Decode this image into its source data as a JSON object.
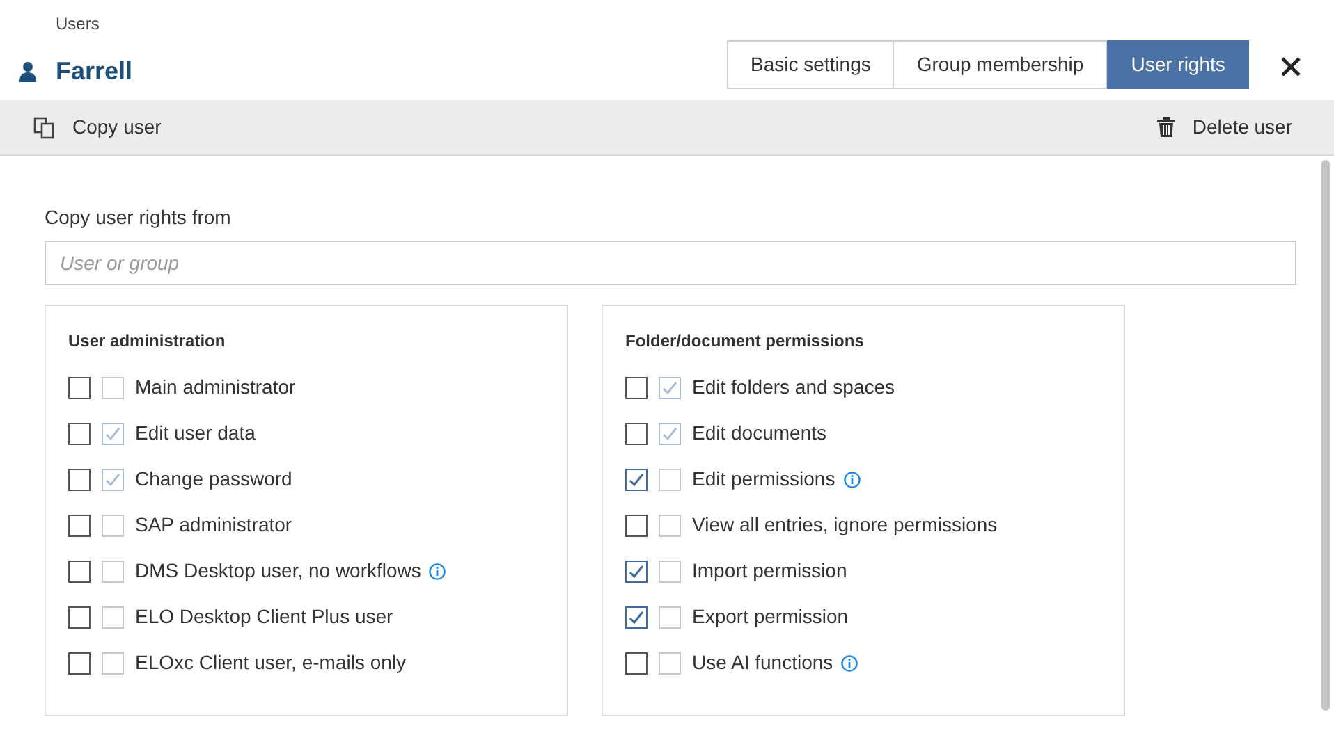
{
  "breadcrumb": "Users",
  "title": "Farrell",
  "tabs": [
    {
      "label": "Basic settings",
      "selected": false
    },
    {
      "label": "Group membership",
      "selected": false
    },
    {
      "label": "User rights",
      "selected": true
    }
  ],
  "toolbar": {
    "copy": "Copy user",
    "delete": "Delete user"
  },
  "copy_from": {
    "label": "Copy user rights from",
    "placeholder": "User or group"
  },
  "panels": [
    {
      "title": "User administration",
      "rights": [
        {
          "label": "Main administrator",
          "checked": false,
          "inherited": false,
          "info": false
        },
        {
          "label": "Edit user data",
          "checked": false,
          "inherited": true,
          "info": false
        },
        {
          "label": "Change password",
          "checked": false,
          "inherited": true,
          "info": false
        },
        {
          "label": "SAP administrator",
          "checked": false,
          "inherited": false,
          "info": false
        },
        {
          "label": "DMS Desktop user, no workflows",
          "checked": false,
          "inherited": false,
          "info": true
        },
        {
          "label": "ELO Desktop Client Plus user",
          "checked": false,
          "inherited": false,
          "info": false
        },
        {
          "label": "ELOxc Client user, e-mails only",
          "checked": false,
          "inherited": false,
          "info": false
        }
      ]
    },
    {
      "title": "Folder/document permissions",
      "rights": [
        {
          "label": "Edit folders and spaces",
          "checked": false,
          "inherited": true,
          "info": false
        },
        {
          "label": "Edit documents",
          "checked": false,
          "inherited": true,
          "info": false
        },
        {
          "label": "Edit permissions",
          "checked": true,
          "inherited": false,
          "info": true
        },
        {
          "label": "View all entries, ignore permissions",
          "checked": false,
          "inherited": false,
          "info": false
        },
        {
          "label": "Import permission",
          "checked": true,
          "inherited": false,
          "info": false
        },
        {
          "label": "Export permission",
          "checked": true,
          "inherited": false,
          "info": false
        },
        {
          "label": "Use AI functions",
          "checked": false,
          "inherited": false,
          "info": true
        }
      ]
    }
  ]
}
